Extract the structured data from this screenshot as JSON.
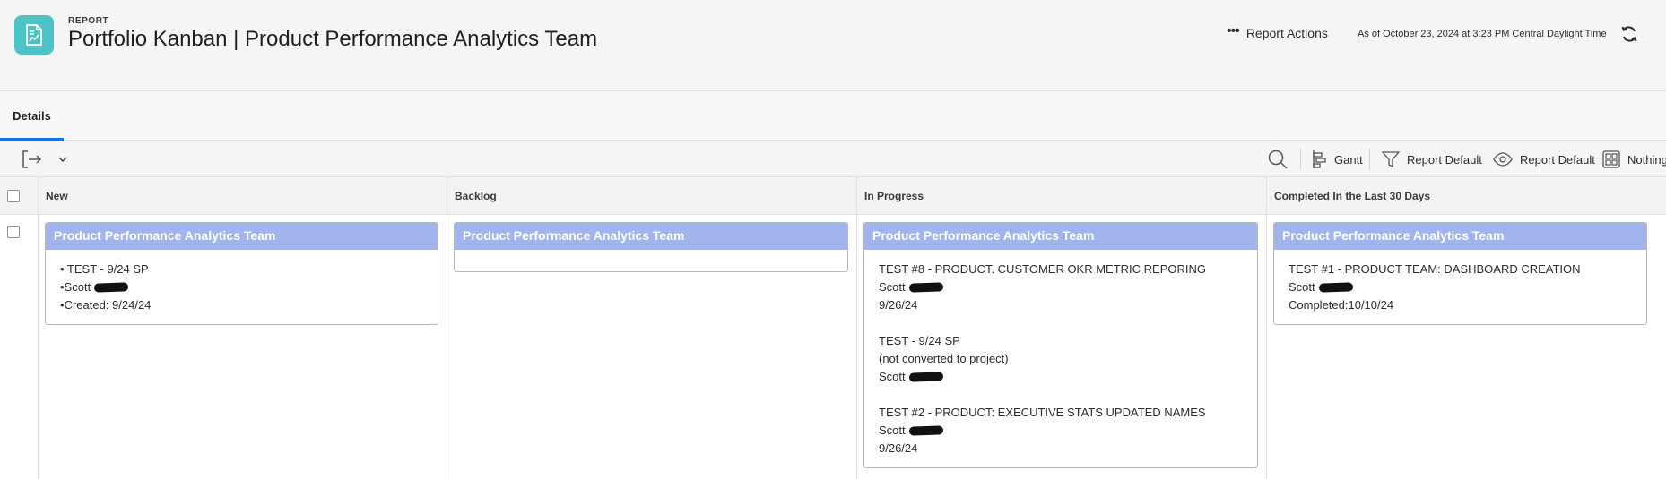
{
  "header": {
    "kicker": "REPORT",
    "title": "Portfolio Kanban | Product Performance Analytics Team",
    "report_actions_label": "Report Actions",
    "as_of": "As of October 23, 2024 at 3:23 PM Central Daylight Time",
    "icons": {
      "app": "report-icon",
      "actions": "more-dots-icon",
      "refresh": "refresh-icon"
    }
  },
  "tabs": [
    {
      "label": "Details",
      "active": true
    }
  ],
  "toolbar": {
    "gantt_label": "Gantt",
    "filter_label": "Report Default",
    "view_label": "Report Default",
    "grouping_label": "Nothing",
    "icons": [
      "export-icon",
      "chevron-down-icon",
      "search-icon",
      "gantt-icon",
      "filter-icon",
      "eye-icon",
      "grid-icon"
    ]
  },
  "columns": [
    {
      "title": "New"
    },
    {
      "title": "Backlog"
    },
    {
      "title": "In Progress"
    },
    {
      "title": "Completed In the Last 30 Days"
    }
  ],
  "cards": {
    "new": {
      "title": "Product Performance Analytics Team",
      "lines": [
        "• TEST - 9/24 SP",
        "•Scott",
        "•Created: 9/24/24"
      ]
    },
    "backlog": {
      "title": "Product Performance Analytics Team"
    },
    "in_progress": {
      "title": "Product Performance Analytics Team",
      "items": [
        {
          "lines": [
            "TEST #8 - PRODUCT. CUSTOMER OKR METRIC REPORING",
            "Scott",
            "9/26/24"
          ]
        },
        {
          "lines": [
            "TEST - 9/24 SP",
            "(not converted to project)",
            "Scott"
          ]
        },
        {
          "lines": [
            "TEST #2 - PRODUCT: EXECUTIVE STATS UPDATED NAMES",
            "Scott",
            "9/26/24"
          ]
        }
      ]
    },
    "completed": {
      "title": "Product Performance Analytics Team",
      "lines": [
        "TEST #1 - PRODUCT TEAM: DASHBOARD CREATION",
        "Scott",
        "Completed:10/10/24"
      ]
    }
  },
  "colors": {
    "card_header": "#a2b4ee",
    "tab_accent": "#1473e6",
    "app_icon": "#4ec3c6"
  }
}
